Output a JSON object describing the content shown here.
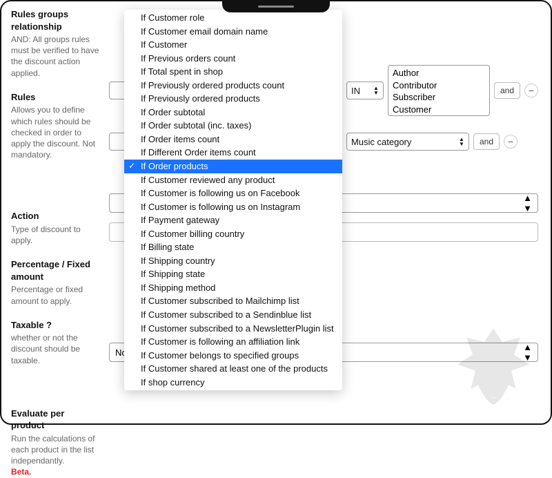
{
  "sidebar": {
    "rulesGroup": {
      "title": "Rules groups relationship",
      "desc": "AND: All groups rules must be verified to have the discount action applied."
    },
    "rules": {
      "title": "Rules",
      "desc": "Allows you to define which rules should be checked in order to apply the discount. Not mandatory."
    },
    "action": {
      "title": "Action",
      "desc": "Type of discount to apply."
    },
    "percentage": {
      "title": "Percentage / Fixed amount",
      "desc": "Percentage or fixed amount to apply."
    },
    "taxable": {
      "title": "Taxable ?",
      "desc": "whether or not the discount should be taxable."
    },
    "evaluate": {
      "title": "Evaluate per product",
      "desc": "Run the calculations of each product in the list independantly.",
      "beta": "Beta."
    }
  },
  "rule1": {
    "operator": "IN",
    "roles": [
      "Author",
      "Contributor",
      "Subscriber",
      "Customer"
    ],
    "andBtn": "and"
  },
  "rule2": {
    "category": "Music category",
    "andBtn": "and"
  },
  "evaluateValue": "No",
  "dropdown": {
    "items": [
      "If Customer role",
      "If Customer email domain name",
      "If Customer",
      "If Previous orders count",
      "If Total spent in shop",
      "If Previously ordered products count",
      "If Previously ordered products",
      "If Order subtotal",
      "If Order subtotal (inc. taxes)",
      "If Order items count",
      "If Different Order items count",
      "If Order products",
      "If Customer reviewed any product",
      "If Customer is following us on Facebook",
      "If Customer is following us on Instagram",
      "If Payment gateway",
      "If Customer billing country",
      "If Billing state",
      "If Shipping country",
      "If Shipping state",
      "If Shipping method",
      "If Customer subscribed to Mailchimp list",
      "If Customer subscribed to a Sendinblue list",
      "If Customer subscribed to a NewsletterPlugin list",
      "If Customer is following an affiliation link",
      "If Customer belongs to specified groups",
      "If Customer shared at least one of the products",
      "If shop currency"
    ],
    "selectedIndex": 11
  }
}
